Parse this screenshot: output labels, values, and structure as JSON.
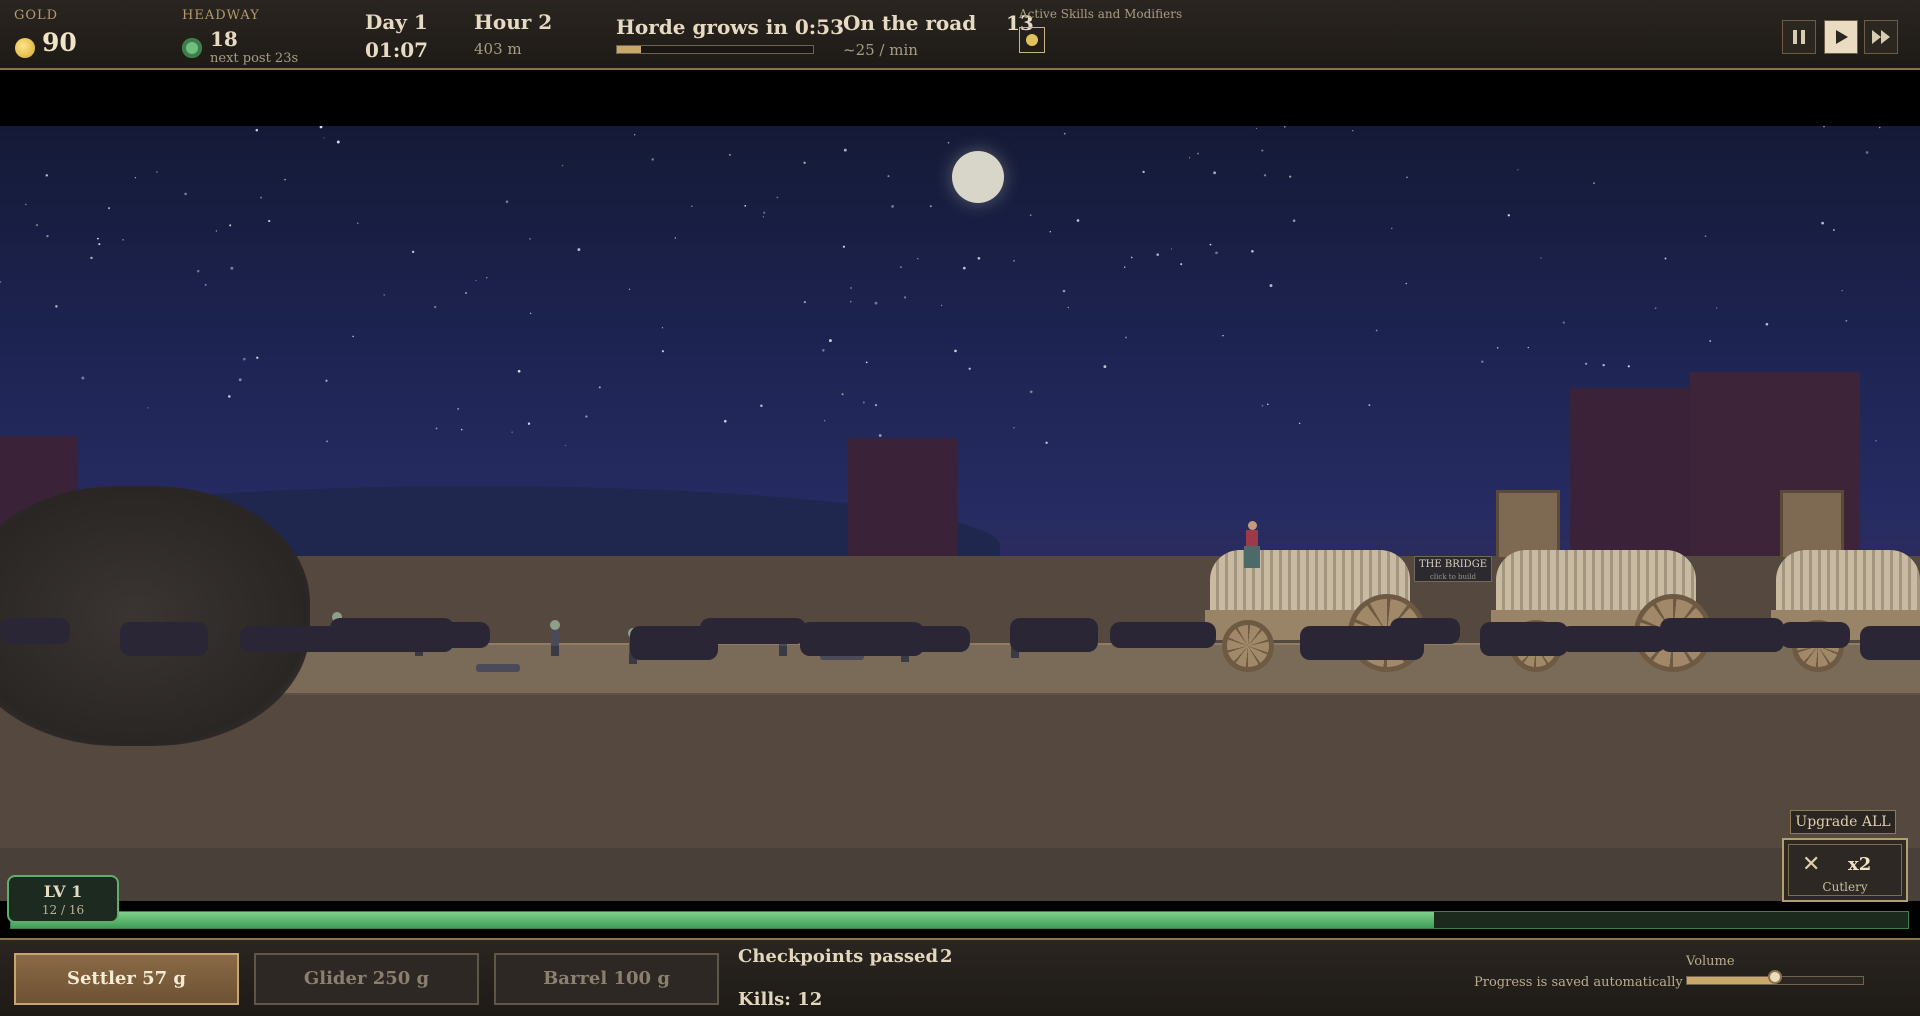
{
  "hud": {
    "gold_label": "GOLD",
    "gold_value": "90",
    "headway_label": "HEADWAY",
    "headway_value": "18",
    "headway_sub": "next post 23s",
    "day": "Day 1",
    "clock": "01:07",
    "hour": "Hour 2",
    "distance": "403 m",
    "horde_text": "Horde grows in 0:53",
    "horde_progress": 0.12,
    "road_label": "On the road",
    "road_value": "13",
    "rate": "~25 / min",
    "skills_label": "Active Skills and Modifiers",
    "skill_icon": "clock-icon",
    "controls": [
      "pause-icon",
      "play-icon",
      "fast-forward-icon"
    ],
    "active_control": "play"
  },
  "scene": {
    "bridge_sign": "THE BRIDGE",
    "bridge_sub": "click to build"
  },
  "upgrades": {
    "upgrade_all": "Upgrade ALL",
    "cutlery_multiplier": "x2",
    "cutlery_name": "Cutlery",
    "cutlery_icon": "cutlery-icon"
  },
  "level": {
    "label": "LV 1",
    "xp": "12 / 16",
    "xp_progress": 0.75
  },
  "bottom": {
    "buy_buttons": [
      {
        "label": "Settler  57 g",
        "active": true
      },
      {
        "label": "Glider  250 g",
        "active": false
      },
      {
        "label": "Barrel  100 g",
        "active": false
      }
    ],
    "checkpoints_label": "Checkpoints passed",
    "checkpoints_value": "2",
    "kills": "Kills: 12",
    "save_note": "Progress is saved automatically",
    "volume_label": "Volume",
    "volume_level": 0.5
  },
  "colors": {
    "accent_gold": "#c9a86a",
    "xp_green": "#3f9d55",
    "sky": "#1e2453"
  }
}
